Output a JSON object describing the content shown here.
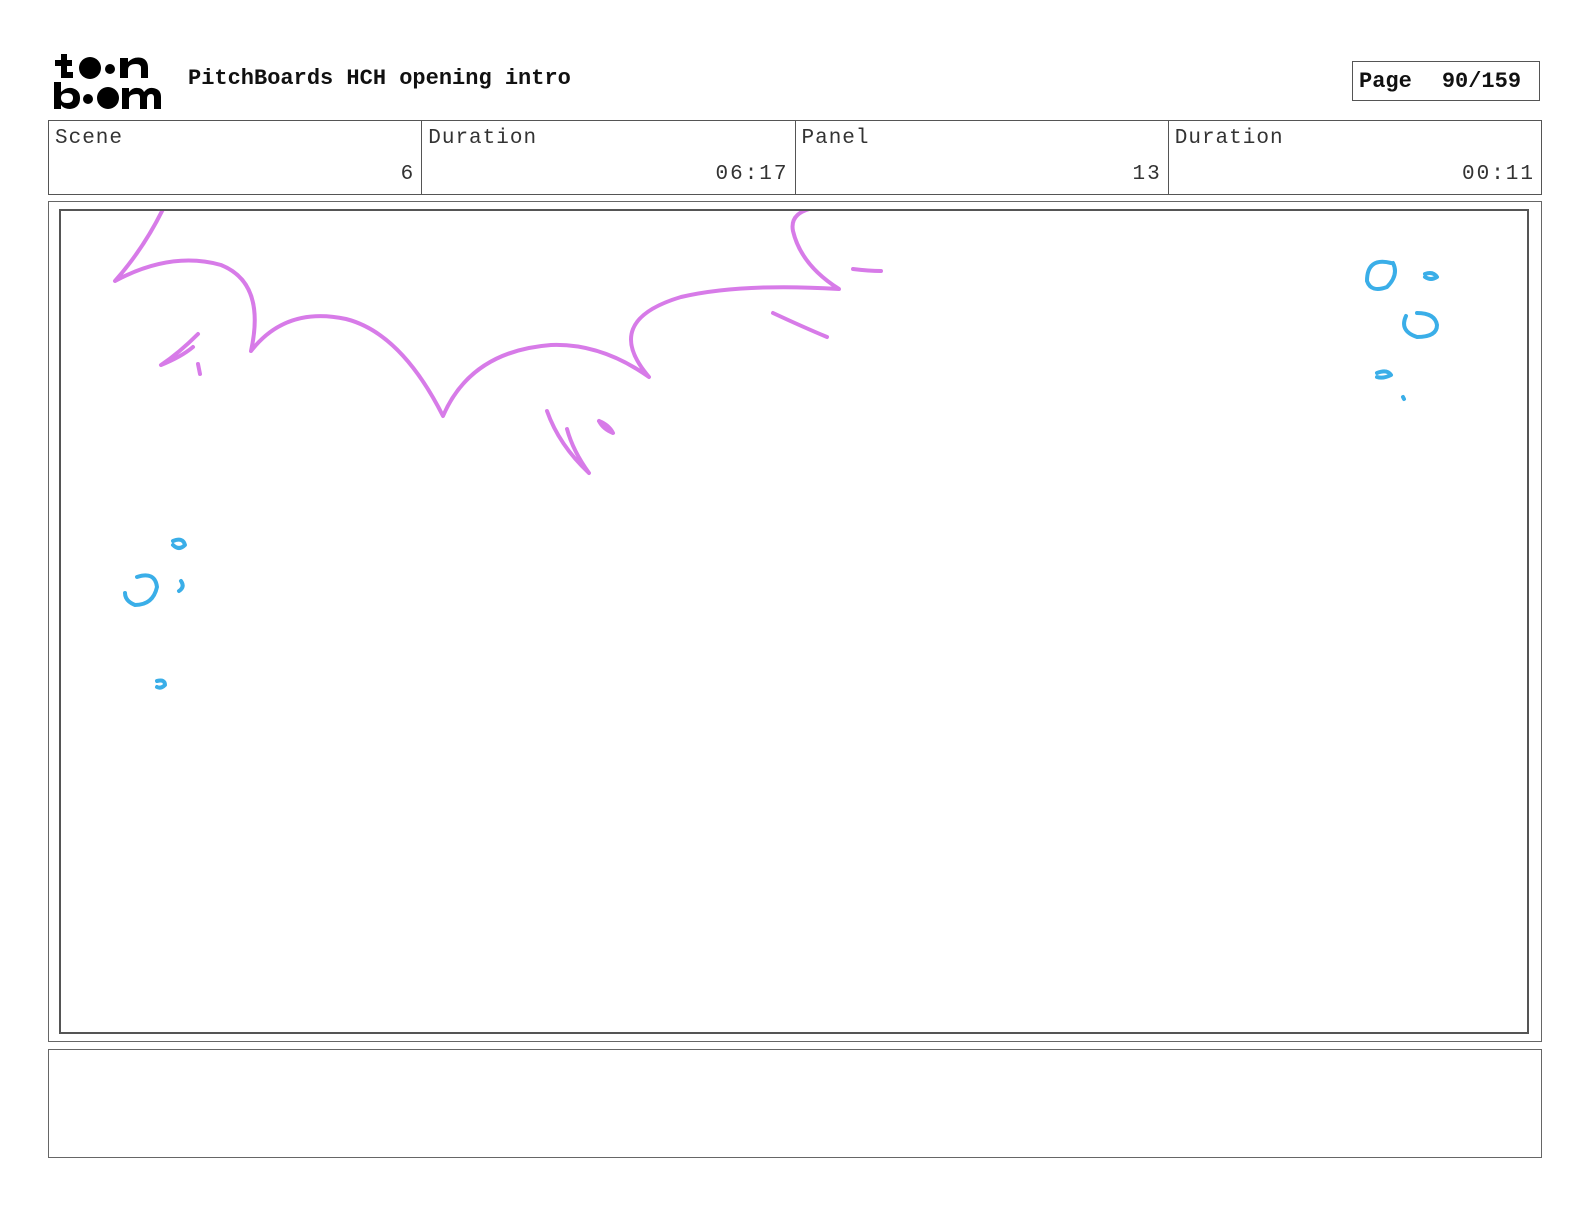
{
  "header": {
    "logo": {
      "icon": "toon-boom-logo",
      "text": "toon boom"
    },
    "title": "PitchBoards HCH opening intro",
    "page_label": "Page",
    "page_number": "90/159"
  },
  "info": {
    "scene_label": "Scene",
    "scene_value": "6",
    "scene_duration_label": "Duration",
    "scene_duration_value": "06:17",
    "panel_label": "Panel",
    "panel_value": "13",
    "panel_duration_label": "Duration",
    "panel_duration_value": "00:11"
  },
  "panel": {
    "sketch": {
      "cloud_color": "#d77be8",
      "bubble_color": "#3aaee8"
    }
  },
  "notes": {
    "text": ""
  }
}
